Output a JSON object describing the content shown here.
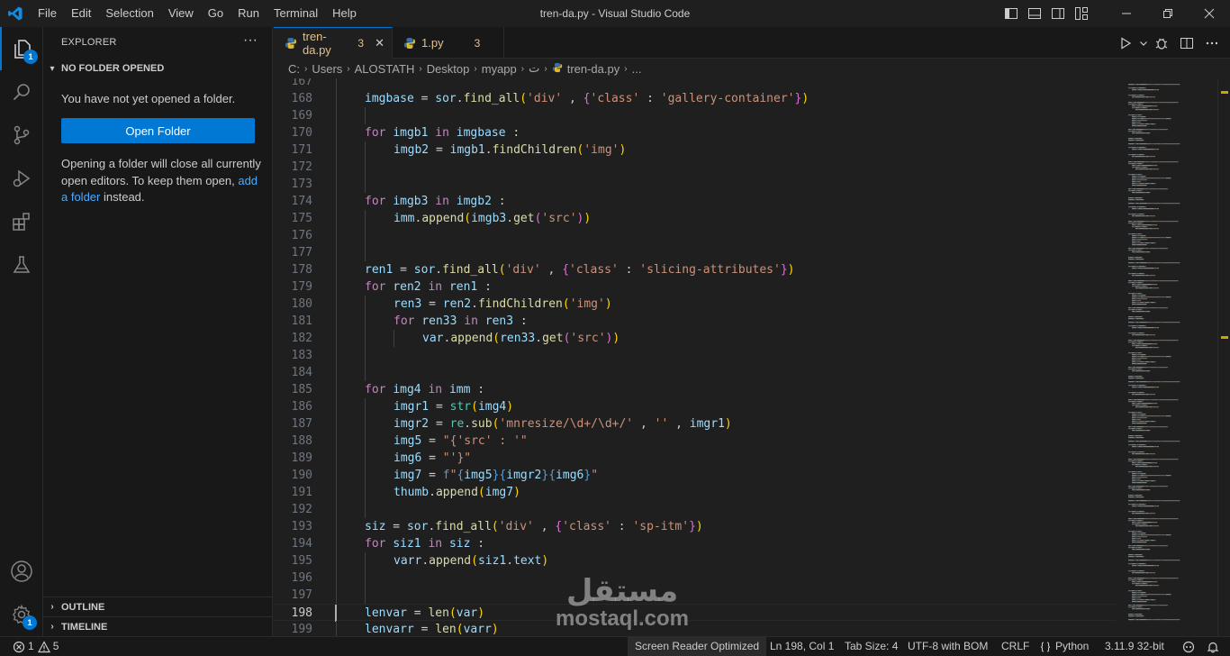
{
  "titlebar": {
    "menu": [
      "File",
      "Edit",
      "Selection",
      "View",
      "Go",
      "Run",
      "Terminal",
      "Help"
    ],
    "window_title": "tren-da.py - Visual Studio Code"
  },
  "activity_bar": {
    "explorer_badge": "1",
    "manage_badge": "1"
  },
  "sidebar": {
    "title": "EXPLORER",
    "more": "···",
    "section": "NO FOLDER OPENED",
    "message": "You have not yet opened a folder.",
    "open_folder_label": "Open Folder",
    "info_before": "Opening a folder will close all currently open editors. To keep them open, ",
    "info_link": "add a folder",
    "info_after": " instead.",
    "outline_label": "OUTLINE",
    "timeline_label": "TIMELINE"
  },
  "tabs": [
    {
      "name": "tren-da.py",
      "problems": "3",
      "active": true
    },
    {
      "name": "1.py",
      "problems": "3",
      "active": false
    }
  ],
  "breadcrumb": [
    "C:",
    "Users",
    "ALOSTATH",
    "Desktop",
    "myapp",
    "ت",
    "tren-da.py",
    "..."
  ],
  "editor": {
    "cursor_line": 198,
    "lines": [
      {
        "n": "167",
        "ind": 0,
        "t": []
      },
      {
        "n": "168",
        "ind": 1,
        "t": [
          [
            "v",
            "imgbase"
          ],
          [
            "p",
            " = "
          ],
          [
            "v",
            "sor"
          ],
          [
            "p",
            "."
          ],
          [
            "f",
            "find_all"
          ],
          [
            "br1",
            "("
          ],
          [
            "s",
            "'div'"
          ],
          [
            "p",
            " , "
          ],
          [
            "br2",
            "{"
          ],
          [
            "s",
            "'class'"
          ],
          [
            "p",
            " : "
          ],
          [
            "s",
            "'gallery-container'"
          ],
          [
            "br2",
            "}"
          ],
          [
            "br1",
            ")"
          ]
        ]
      },
      {
        "n": "169",
        "ind": 1,
        "t": []
      },
      {
        "n": "170",
        "ind": 1,
        "t": [
          [
            "kc",
            "for"
          ],
          [
            "p",
            " "
          ],
          [
            "v",
            "imgb1"
          ],
          [
            "p",
            " "
          ],
          [
            "kc",
            "in"
          ],
          [
            "p",
            " "
          ],
          [
            "v",
            "imgbase"
          ],
          [
            "p",
            " :"
          ]
        ]
      },
      {
        "n": "171",
        "ind": 2,
        "t": [
          [
            "v",
            "imgb2"
          ],
          [
            "p",
            " = "
          ],
          [
            "v",
            "imgb1"
          ],
          [
            "p",
            "."
          ],
          [
            "f",
            "findChildren"
          ],
          [
            "br1",
            "("
          ],
          [
            "s",
            "'img'"
          ],
          [
            "br1",
            ")"
          ]
        ]
      },
      {
        "n": "172",
        "ind": 1,
        "t": []
      },
      {
        "n": "173",
        "ind": 1,
        "t": []
      },
      {
        "n": "174",
        "ind": 1,
        "t": [
          [
            "kc",
            "for"
          ],
          [
            "p",
            " "
          ],
          [
            "v",
            "imgb3"
          ],
          [
            "p",
            " "
          ],
          [
            "kc",
            "in"
          ],
          [
            "p",
            " "
          ],
          [
            "v",
            "imgb2"
          ],
          [
            "p",
            " :"
          ]
        ]
      },
      {
        "n": "175",
        "ind": 2,
        "t": [
          [
            "v",
            "imm"
          ],
          [
            "p",
            "."
          ],
          [
            "f",
            "append"
          ],
          [
            "br1",
            "("
          ],
          [
            "v",
            "imgb3"
          ],
          [
            "p",
            "."
          ],
          [
            "f",
            "get"
          ],
          [
            "br2",
            "("
          ],
          [
            "s",
            "'src'"
          ],
          [
            "br2",
            ")"
          ],
          [
            "br1",
            ")"
          ]
        ]
      },
      {
        "n": "176",
        "ind": 1,
        "t": []
      },
      {
        "n": "177",
        "ind": 1,
        "t": []
      },
      {
        "n": "178",
        "ind": 1,
        "t": [
          [
            "v",
            "ren1"
          ],
          [
            "p",
            " = "
          ],
          [
            "v",
            "sor"
          ],
          [
            "p",
            "."
          ],
          [
            "f",
            "find_all"
          ],
          [
            "br1",
            "("
          ],
          [
            "s",
            "'div'"
          ],
          [
            "p",
            " , "
          ],
          [
            "br2",
            "{"
          ],
          [
            "s",
            "'class'"
          ],
          [
            "p",
            " : "
          ],
          [
            "s",
            "'slicing-attributes'"
          ],
          [
            "br2",
            "}"
          ],
          [
            "br1",
            ")"
          ]
        ]
      },
      {
        "n": "179",
        "ind": 1,
        "t": [
          [
            "kc",
            "for"
          ],
          [
            "p",
            " "
          ],
          [
            "v",
            "ren2"
          ],
          [
            "p",
            " "
          ],
          [
            "kc",
            "in"
          ],
          [
            "p",
            " "
          ],
          [
            "v",
            "ren1"
          ],
          [
            "p",
            " :"
          ]
        ]
      },
      {
        "n": "180",
        "ind": 2,
        "t": [
          [
            "v",
            "ren3"
          ],
          [
            "p",
            " = "
          ],
          [
            "v",
            "ren2"
          ],
          [
            "p",
            "."
          ],
          [
            "f",
            "findChildren"
          ],
          [
            "br1",
            "("
          ],
          [
            "s",
            "'img'"
          ],
          [
            "br1",
            ")"
          ]
        ]
      },
      {
        "n": "181",
        "ind": 2,
        "t": [
          [
            "kc",
            "for"
          ],
          [
            "p",
            " "
          ],
          [
            "v",
            "ren33"
          ],
          [
            "p",
            " "
          ],
          [
            "kc",
            "in"
          ],
          [
            "p",
            " "
          ],
          [
            "v",
            "ren3"
          ],
          [
            "p",
            " :"
          ]
        ]
      },
      {
        "n": "182",
        "ind": 3,
        "t": [
          [
            "v",
            "var"
          ],
          [
            "p",
            "."
          ],
          [
            "f",
            "append"
          ],
          [
            "br1",
            "("
          ],
          [
            "v",
            "ren33"
          ],
          [
            "p",
            "."
          ],
          [
            "f",
            "get"
          ],
          [
            "br2",
            "("
          ],
          [
            "s",
            "'src'"
          ],
          [
            "br2",
            ")"
          ],
          [
            "br1",
            ")"
          ]
        ]
      },
      {
        "n": "183",
        "ind": 1,
        "t": []
      },
      {
        "n": "184",
        "ind": 1,
        "t": []
      },
      {
        "n": "185",
        "ind": 1,
        "t": [
          [
            "kc",
            "for"
          ],
          [
            "p",
            " "
          ],
          [
            "v",
            "img4"
          ],
          [
            "p",
            " "
          ],
          [
            "kc",
            "in"
          ],
          [
            "p",
            " "
          ],
          [
            "v",
            "imm"
          ],
          [
            "p",
            " :"
          ]
        ]
      },
      {
        "n": "186",
        "ind": 2,
        "t": [
          [
            "v",
            "imgr1"
          ],
          [
            "p",
            " = "
          ],
          [
            "b",
            "str"
          ],
          [
            "br1",
            "("
          ],
          [
            "v",
            "img4"
          ],
          [
            "br1",
            ")"
          ]
        ]
      },
      {
        "n": "187",
        "ind": 2,
        "t": [
          [
            "v",
            "imgr2"
          ],
          [
            "p",
            " = "
          ],
          [
            "b",
            "re"
          ],
          [
            "p",
            "."
          ],
          [
            "f",
            "sub"
          ],
          [
            "br1",
            "("
          ],
          [
            "s",
            "'mnresize/\\d+/\\d+/'"
          ],
          [
            "p",
            " , "
          ],
          [
            "s",
            "''"
          ],
          [
            "p",
            " , "
          ],
          [
            "v",
            "imgr1"
          ],
          [
            "br1",
            ")"
          ]
        ]
      },
      {
        "n": "188",
        "ind": 2,
        "t": [
          [
            "v",
            "img5"
          ],
          [
            "p",
            " = "
          ],
          [
            "s",
            "\"{'src' : '\""
          ]
        ]
      },
      {
        "n": "189",
        "ind": 2,
        "t": [
          [
            "v",
            "img6"
          ],
          [
            "p",
            " = "
          ],
          [
            "s",
            "\"'}\""
          ]
        ]
      },
      {
        "n": "190",
        "ind": 2,
        "t": [
          [
            "v",
            "img7"
          ],
          [
            "p",
            " = "
          ],
          [
            "k",
            "f"
          ],
          [
            "s",
            "\""
          ],
          [
            "k",
            "{"
          ],
          [
            "v",
            "img5"
          ],
          [
            "k",
            "}{"
          ],
          [
            "v",
            "imgr2"
          ],
          [
            "k",
            "}{"
          ],
          [
            "v",
            "img6"
          ],
          [
            "k",
            "}"
          ],
          [
            "s",
            "\""
          ]
        ]
      },
      {
        "n": "191",
        "ind": 2,
        "t": [
          [
            "v",
            "thumb"
          ],
          [
            "p",
            "."
          ],
          [
            "f",
            "append"
          ],
          [
            "br1",
            "("
          ],
          [
            "v",
            "img7"
          ],
          [
            "br1",
            ")"
          ]
        ]
      },
      {
        "n": "192",
        "ind": 1,
        "t": []
      },
      {
        "n": "193",
        "ind": 1,
        "t": [
          [
            "v",
            "siz"
          ],
          [
            "p",
            " = "
          ],
          [
            "v",
            "sor"
          ],
          [
            "p",
            "."
          ],
          [
            "f",
            "find_all"
          ],
          [
            "br1",
            "("
          ],
          [
            "s",
            "'div'"
          ],
          [
            "p",
            " , "
          ],
          [
            "br2",
            "{"
          ],
          [
            "s",
            "'class'"
          ],
          [
            "p",
            " : "
          ],
          [
            "s",
            "'sp-itm'"
          ],
          [
            "br2",
            "}"
          ],
          [
            "br1",
            ")"
          ]
        ]
      },
      {
        "n": "194",
        "ind": 1,
        "t": [
          [
            "kc",
            "for"
          ],
          [
            "p",
            " "
          ],
          [
            "v",
            "siz1"
          ],
          [
            "p",
            " "
          ],
          [
            "kc",
            "in"
          ],
          [
            "p",
            " "
          ],
          [
            "v",
            "siz"
          ],
          [
            "p",
            " :"
          ]
        ]
      },
      {
        "n": "195",
        "ind": 2,
        "t": [
          [
            "v",
            "varr"
          ],
          [
            "p",
            "."
          ],
          [
            "f",
            "append"
          ],
          [
            "br1",
            "("
          ],
          [
            "v",
            "siz1"
          ],
          [
            "p",
            "."
          ],
          [
            "v",
            "text"
          ],
          [
            "br1",
            ")"
          ]
        ]
      },
      {
        "n": "196",
        "ind": 1,
        "t": []
      },
      {
        "n": "197",
        "ind": 1,
        "t": []
      },
      {
        "n": "198",
        "ind": 1,
        "t": [
          [
            "v",
            "lenvar"
          ],
          [
            "p",
            " = "
          ],
          [
            "f",
            "len"
          ],
          [
            "br1",
            "("
          ],
          [
            "v",
            "var"
          ],
          [
            "br1",
            ")"
          ]
        ]
      },
      {
        "n": "199",
        "ind": 1,
        "t": [
          [
            "v",
            "lenvarr"
          ],
          [
            "p",
            " = "
          ],
          [
            "f",
            "len"
          ],
          [
            "br1",
            "("
          ],
          [
            "v",
            "varr"
          ],
          [
            "br1",
            ")"
          ]
        ]
      }
    ]
  },
  "watermark": {
    "arabic": "مستقل",
    "latin": "mostaql.com"
  },
  "statusbar": {
    "errors": "1",
    "warnings": "5",
    "screen_reader": "Screen Reader Optimized",
    "position": "Ln 198, Col 1",
    "tab_size": "Tab Size: 4",
    "encoding": "UTF-8 with BOM",
    "eol": "CRLF",
    "language": "Python",
    "interpreter": "3.11.9 32-bit"
  },
  "colors": {
    "accent": "#0078d4",
    "background": "#1f1f1f",
    "sidebar": "#181818"
  }
}
